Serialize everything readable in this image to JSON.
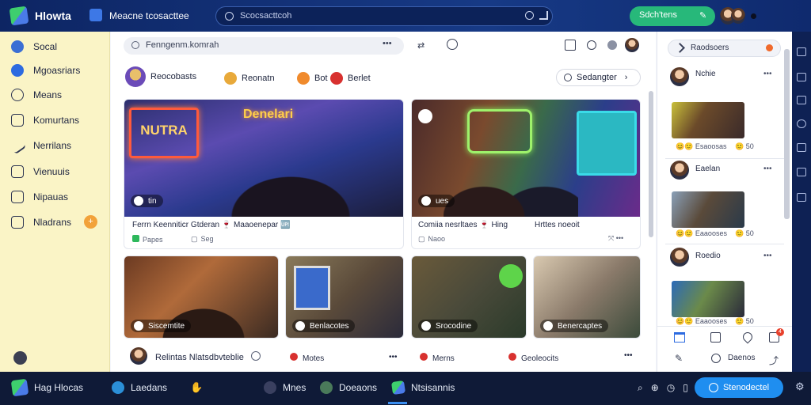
{
  "topbar": {
    "app_name": "Hlowta",
    "nav_label": "Meacne tcosacttee",
    "search_placeholder": "Scocsacttcoh",
    "join_label": "Sdch'tens"
  },
  "sidebar": {
    "items": [
      {
        "label": "Socal",
        "icon": "globe-icon"
      },
      {
        "label": "Mgoasriars",
        "icon": "facebook-icon"
      },
      {
        "label": "Means",
        "icon": "chat-icon"
      },
      {
        "label": "Komurtans",
        "icon": "document-icon"
      },
      {
        "label": "Nerrilans",
        "icon": "pen-icon"
      },
      {
        "label": "Vienuuis",
        "icon": "list-icon"
      },
      {
        "label": "Nipauas",
        "icon": "book-icon"
      },
      {
        "label": "Nladrans",
        "icon": "grid-icon"
      }
    ],
    "last_badge": "+"
  },
  "subbar": {
    "search_text": "Fenngenm.komrah"
  },
  "filters": [
    {
      "label": "Reocobasts",
      "icon": "avatar-icon"
    },
    {
      "label": "Reonatn",
      "icon": "coin-icon"
    },
    {
      "label": "Bot",
      "icon": "fruit-icon"
    },
    {
      "label": "Berlet",
      "icon": "apple-icon"
    }
  ],
  "sort_label": "Sedangter",
  "cards_top": [
    {
      "banner": "Denelari",
      "neon": "NUTRA",
      "tag": "tin",
      "title": "Ferrn Keenniticr Gtderan 🍷 Maaoenepar 🆙",
      "meta": "Papes",
      "meta2": "Seg"
    },
    {
      "banner": "",
      "neon": "",
      "tag": "ues",
      "title": "Comiia nesrltaes 🍷 Hing",
      "title2": "Hrttes noeoit",
      "meta": "Naoo"
    }
  ],
  "cards_bottom": [
    {
      "tag": "Siscemtite"
    },
    {
      "tag": "Benlacotes"
    },
    {
      "tag": "Srocodine"
    },
    {
      "tag": "Benercaptes"
    }
  ],
  "card_footer": {
    "author": "Relintas Nlatsdbvteblie",
    "a1": "Motes",
    "a2": "Merns",
    "a3": "Geoleocits"
  },
  "rpanel": {
    "search_text": "Raodsoers",
    "posts": [
      {
        "name": "Nchie",
        "likes": "Esaoosas",
        "count": "50"
      },
      {
        "name": "Eaelan",
        "likes": "Eaaooses",
        "count": "50"
      },
      {
        "name": "Roedio",
        "likes": "Eaaooses",
        "count": "50"
      }
    ],
    "footer_label": "Daenos",
    "notif_count": "4"
  },
  "taskbar": {
    "t1": "Hag Hlocas",
    "t2": "Laedans",
    "t3": "Mnes",
    "t4": "Doeaons",
    "t5": "Ntsisannis",
    "cta": "Stenodectel",
    "cta_badge": "0"
  },
  "colors": {
    "accent_green": "#27b87a",
    "accent_blue": "#1f8ef0",
    "sidebar_bg": "#faf4c6",
    "topbar_bg": "#0d2563"
  }
}
